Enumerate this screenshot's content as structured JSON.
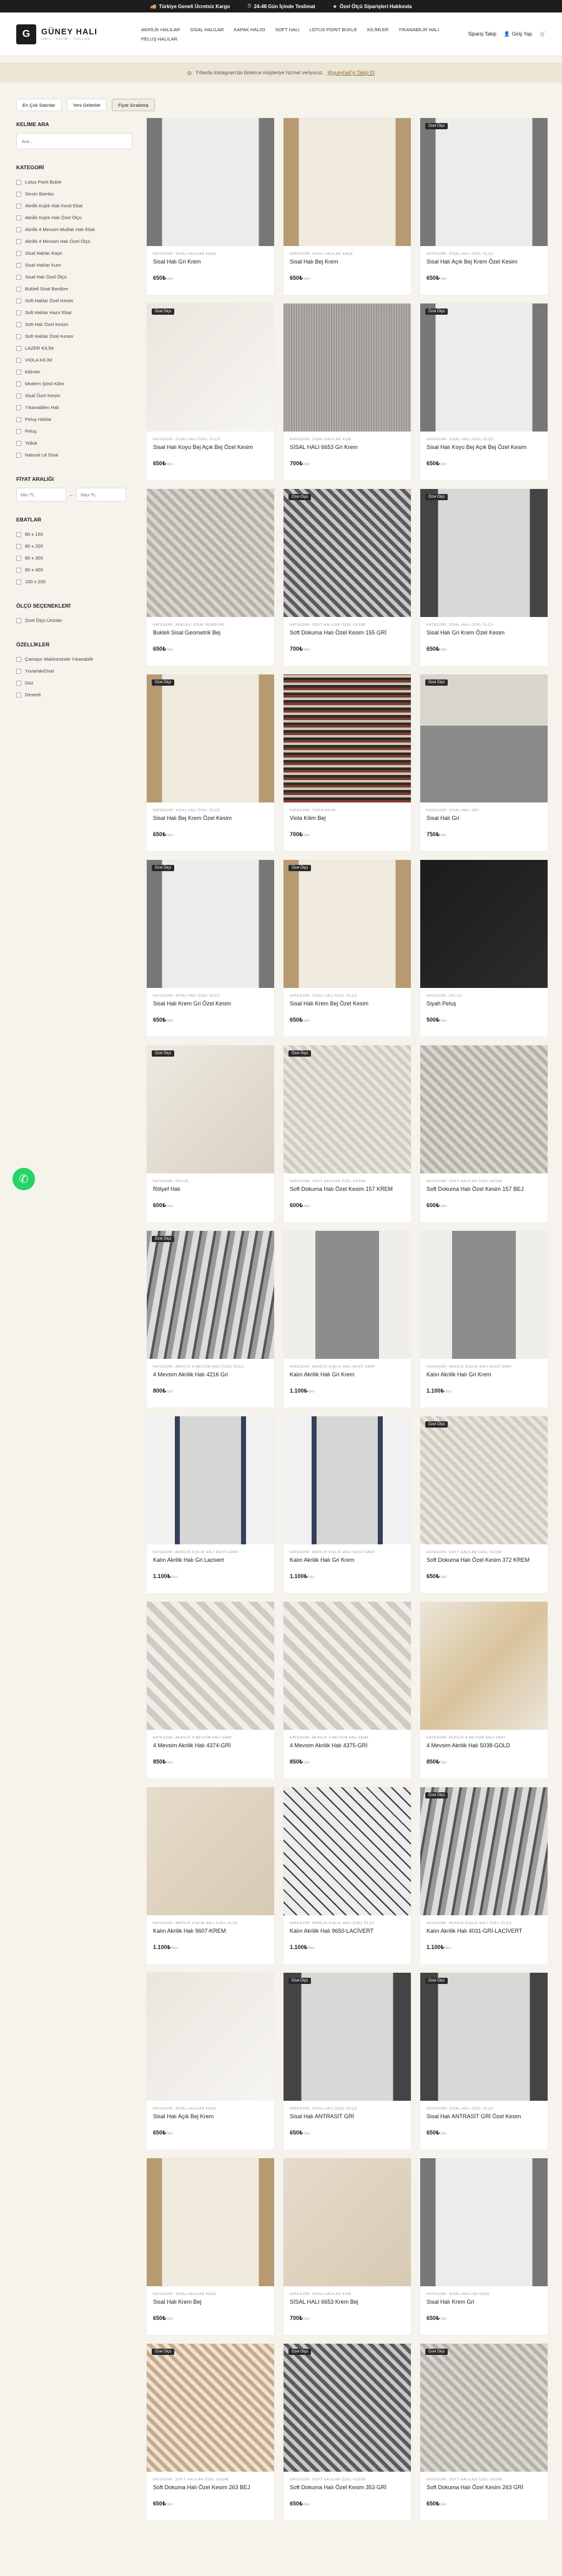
{
  "topbar": {
    "items": [
      {
        "icon": "truck-icon",
        "text": "Türkiye Geneli Ücretsiz Kargo"
      },
      {
        "icon": "clock-icon",
        "text": "24-48 Gün İçinde Teslimat"
      },
      {
        "icon": "star-icon",
        "text": "Özel Ölçü Siparişleri Hakkında"
      }
    ]
  },
  "header": {
    "logo_initial": "G",
    "logo_text": "GÜNEY HALI",
    "logo_sub": "HALI · KİLİM · YOLLUK",
    "nav": [
      "AKRİLİK HALILAR",
      "SİSAL HALILAR",
      "KAPAK HALISI",
      "SOFT HALI",
      "LOTUS POINT BUKLE",
      "KİLİMLER",
      "YIKANABİLİR HALI",
      "PELUŞ HALILAR"
    ],
    "order_track": "Sipariş Takip",
    "login": "Giriş Yap"
  },
  "notice": {
    "text": "Yıllarda Instagram'da binlerce müşteriye hizmet veriyoruz.",
    "link": "@gunyhali'yi Takip Et"
  },
  "sort": [
    "En Çok Satınlar",
    "Yeni Gelenler",
    "Fiyat Sıralama"
  ],
  "sidebar": {
    "search_title": "KELİME ARA",
    "search_placeholder": "Ara...",
    "category_title": "KATEGORİ",
    "categories": [
      "Lotus Point Bukle",
      "Sinsin Bambu",
      "Akrilik Kışlık Halı Kesit Ebat",
      "Akrilik Kışlık Halı Özel Ölçü",
      "Akrilik 4 Mevsim Mutfak Halı Ebat",
      "Akrilik 4 Mevsim Halı Özel Ölçü",
      "Sisal Halılar Kaçe",
      "Sisal Halılar Kum",
      "Sisal Halı Özel Ölçü",
      "Bukleli Sisal Bordüre",
      "Soft Halılar Özel Kesim",
      "Soft Halılar Hazır Ebat",
      "Soft Halı Özel Kesim",
      "Soft Halılar Özel Kesim",
      "LAZER KİLİM",
      "VIOLA KİLİM",
      "Kilimler",
      "Modern Şönil Kilim",
      "Sisal Özel Kesim",
      "Yıkanabilen Halı",
      "Peluş Halılar",
      "Peluş",
      "Yolluk",
      "Natural Ld Sisal"
    ],
    "price_title": "FİYAT ARALIĞI",
    "price_min": "Min TL",
    "price_max": "Max TL",
    "size_title": "EBATLAR",
    "sizes": [
      "80 x 150",
      "80 x 200",
      "80 x 300",
      "80 x 400",
      "100 x 200"
    ],
    "size_option_title": "ÖLÇÜ SEÇENEKLERİ",
    "size_options": [
      "Özel Ölçü Ürünler"
    ],
    "features_title": "ÖZELLİKLER",
    "features": [
      "Çamaşır Makinesinde Yıkanabilir",
      "Yuvarlak/Oval",
      "Düz",
      "Desenli"
    ]
  },
  "products": [
    {
      "badge": "",
      "cat": "KATEGORİ: SİSAL HALILAR KAÇE",
      "name": "Sisal Halı Gri Krem",
      "price": "650₺",
      "style": "gray-border"
    },
    {
      "badge": "",
      "cat": "KATEGORİ: SİSAL HALILAR KAÇE",
      "name": "Sisal Halı Bej Krem",
      "price": "650₺",
      "style": "beige-border"
    },
    {
      "badge": "Özel Ölçü",
      "cat": "KATEGORİ: SİSAL HALI ÖZEL ÖLÇÜ",
      "name": "Sisal Halı Açık Bej Krem Özel Kesim",
      "price": "650₺",
      "style": "gray-border"
    },
    {
      "badge": "Özel Ölçü",
      "cat": "KATEGORİ: SİSAL HALI ÖZEL ÖLÇÜ",
      "name": "Sisal Halı Koyu Bej Açık Bej Özel Kesim",
      "price": "650₺",
      "style": "light"
    },
    {
      "badge": "",
      "cat": "KATEGORİ: SİSAL HALILAR KUM",
      "name": "SİSAL HALI 6653 Gri Krem",
      "price": "700₺",
      "style": "plain-gray"
    },
    {
      "badge": "Özel Ölçü",
      "cat": "KATEGORİ: SİSAL HALI ÖZEL ÖLÇÜ",
      "name": "Sisal Halı Koyu Bej Açık Bej Özel Kesim",
      "price": "650₺",
      "style": "gray-border"
    },
    {
      "badge": "",
      "cat": "KATEGORİ: BUKLELİ SİSAL BORDÜRE",
      "name": "Bukleli Sisal Geometrik Bej",
      "price": "650₺",
      "style": "pattern-gray"
    },
    {
      "badge": "Özel Ölçü",
      "cat": "KATEGORİ: SOFT HALILAR ÖZEL KESİM",
      "name": "Soft Dokuma Halı Özel Kesim 155 GRİ",
      "price": "700₺",
      "style": "pattern-dark"
    },
    {
      "badge": "Özel Ölçü",
      "cat": "KATEGORİ: SİSAL HALI ÖZEL ÖLÇÜ",
      "name": "Sisal Halı Gri Krem Özel Kesim",
      "price": "650₺",
      "style": "dark-border"
    },
    {
      "badge": "Özel Ölçü",
      "cat": "KATEGORİ: SİSAL HALI ÖZEL ÖLÇÜ",
      "name": "Sisal Halı Bej Krem Özel Kesim",
      "price": "650₺",
      "style": "beige-border"
    },
    {
      "badge": "",
      "cat": "KATEGORİ: VIOLA KİLİM",
      "name": "Viola Kilim Bej",
      "price": "700₺",
      "style": "stripe"
    },
    {
      "badge": "Özel Ölçü",
      "cat": "KATEGORİ: SİSAL HALI GRİ",
      "name": "Sisal Halı Gri",
      "price": "750₺",
      "style": "room"
    },
    {
      "badge": "Özel Ölçü",
      "cat": "KATEGORİ: SİSAL HALI ÖZEL ÖLÇÜ",
      "name": "Sisal Halı Krem Gri Özel Kesim",
      "price": "650₺",
      "style": "gray-border"
    },
    {
      "badge": "Özel Ölçü",
      "cat": "KATEGORİ: SİSAL HALI ÖZEL ÖLÇÜ",
      "name": "Sisal Halı Krem Bej Özel Kesim",
      "price": "650₺",
      "style": "beige-border"
    },
    {
      "badge": "",
      "cat": "KATEGORİ: PELUŞ",
      "name": "Siyah Peluş",
      "price": "500₺",
      "style": "black"
    },
    {
      "badge": "Özel Ölçü",
      "cat": "KATEGORİ: PELUŞ",
      "name": "Rölyef Halı",
      "price": "600₺",
      "style": "cream"
    },
    {
      "badge": "Özel Ölçü",
      "cat": "KATEGORİ: SOFT HALILAR ÖZEL KESİM",
      "name": "Soft Dokuma Halı Özel Kesim 157 KREM",
      "price": "600₺",
      "style": "pattern-cream"
    },
    {
      "badge": "",
      "cat": "KATEGORİ: SOFT HALILAR ÖZEL KESİM",
      "name": "Soft Dokuma Halı Özel Kesim 157 BEJ",
      "price": "600₺",
      "style": "pattern-gray"
    },
    {
      "badge": "Özel Ölçü",
      "cat": "KATEGORİ: AKRİLİK 4 MEVSİM HALI ÖZEL ÖLÇÜ",
      "name": "4 Mevsim Akrilik Halı 4216 Gri",
      "price": "800₺",
      "style": "abstract"
    },
    {
      "badge": "",
      "cat": "KATEGORİ: AKRİLİK KIŞLIK HALI KESİT EBAT",
      "name": "Kalın Akrilik Halı Gri Krem",
      "price": "1.100₺",
      "style": "runner-gray"
    },
    {
      "badge": "",
      "cat": "KATEGORİ: AKRİLİK KIŞLIK HALI KESİT EBAT",
      "name": "Kalın Akrilik Halı Gri Krem",
      "price": "1.100₺",
      "style": "runner-gray"
    },
    {
      "badge": "",
      "cat": "KATEGORİ: AKRİLİK KIŞLIK HALI KESİT EBAT",
      "name": "Kalın Akrilik Halı Gri Lacivert",
      "price": "1.100₺",
      "style": "runner-stripe"
    },
    {
      "badge": "",
      "cat": "KATEGORİ: AKRİLİK KIŞLIK HALI KESİT EBAT",
      "name": "Kalın Akrilik Halı Gri Krem",
      "price": "1.100₺",
      "style": "runner-stripe"
    },
    {
      "badge": "Özel Ölçü",
      "cat": "KATEGORİ: SOFT HALILAR ÖZEL KESİM",
      "name": "Soft Dokuma Halı Özel Kesim 372 KREM",
      "price": "650₺",
      "style": "pattern-cream"
    },
    {
      "badge": "",
      "cat": "KATEGORİ: AKRİLİK 4 MEVSİM HALI EBAT",
      "name": "4 Mevsim Akrilik Halı 4374-GRİ",
      "price": "850₺",
      "style": "geo"
    },
    {
      "badge": "",
      "cat": "KATEGORİ: AKRİLİK 4 MEVSİM HALI EBAT",
      "name": "4 Mevsim Akrilik Halı 4375-GRİ",
      "price": "850₺",
      "style": "geo"
    },
    {
      "badge": "",
      "cat": "KATEGORİ: AKRİLİK 4 MEVSİM HALI EBAT",
      "name": "4 Mevsim Akrilik Halı 5038-GOLD",
      "price": "850₺",
      "style": "marble"
    },
    {
      "badge": "",
      "cat": "KATEGORİ: AKRİLİK KIŞLIK HALI ÖZEL ÖLÇÜ",
      "name": "Kalın Akrilik Halı 9607-KREM",
      "price": "1.100₺",
      "style": "plain-beige"
    },
    {
      "badge": "",
      "cat": "KATEGORİ: AKRİLİK KIŞLIK HALI ÖZEL ÖLÇÜ",
      "name": "Kalın Akrilik Halı 9650-LACİVERT",
      "price": "1.100₺",
      "style": "lattice"
    },
    {
      "badge": "Özel Ölçü",
      "cat": "KATEGORİ: AKRİLİK KIŞLIK HALI ÖZEL ÖLÇÜ",
      "name": "Kalın Akrilik Halı 4031-GRİ-LACİVERT",
      "price": "1.100₺",
      "style": "abstract"
    },
    {
      "badge": "",
      "cat": "KATEGORİ: SİSAL HALILAR KAÇE",
      "name": "Sisal Halı Açık Bej Krem",
      "price": "650₺",
      "style": "light"
    },
    {
      "badge": "Özel Ölçü",
      "cat": "KATEGORİ: SİSAL HALI ÖZEL ÖLÇÜ",
      "name": "Sisal Halı ANTRASİT GRİ",
      "price": "650₺",
      "style": "dark-border"
    },
    {
      "badge": "Özel Ölçü",
      "cat": "KATEGORİ: SİSAL HALI ÖZEL ÖLÇÜ",
      "name": "Sisal Halı ANTRASİT GRİ Özel Kesim",
      "price": "650₺",
      "style": "dark-border"
    },
    {
      "badge": "",
      "cat": "KATEGORİ: SİSAL HALILAR KAÇE",
      "name": "Sisal Halı Krem Bej",
      "price": "650₺",
      "style": "beige-border"
    },
    {
      "badge": "",
      "cat": "KATEGORİ: SİSAL HALILAR KUM",
      "name": "SİSAL HALI 6653 Krem Bej",
      "price": "700₺",
      "style": "plain-beige"
    },
    {
      "badge": "",
      "cat": "KATEGORİ: SİSAL HALILAR KAÇE",
      "name": "Sisal Halı Krem Gri",
      "price": "650₺",
      "style": "gray-border"
    },
    {
      "badge": "Özel Ölçü",
      "cat": "KATEGORİ: SOFT HALILAR ÖZEL KESİM",
      "name": "Soft Dokuma Halı Özel Kesim 263 BEJ",
      "price": "650₺",
      "style": "pattern-beige"
    },
    {
      "badge": "Özel Ölçü",
      "cat": "KATEGORİ: SOFT HALILAR ÖZEL KESİM",
      "name": "Soft Dokuma Halı Özel Kesim 353 GRİ",
      "price": "650₺",
      "style": "pattern-dark"
    },
    {
      "badge": "Özel Ölçü",
      "cat": "KATEGORİ: SOFT HALILAR ÖZEL KESİM",
      "name": "Soft Dokuma Halı Özel Kesim 263 GRİ",
      "price": "650₺",
      "style": "pattern-gray"
    }
  ],
  "price_suffix": "'den",
  "whatsapp_icon": "whatsapp-icon"
}
